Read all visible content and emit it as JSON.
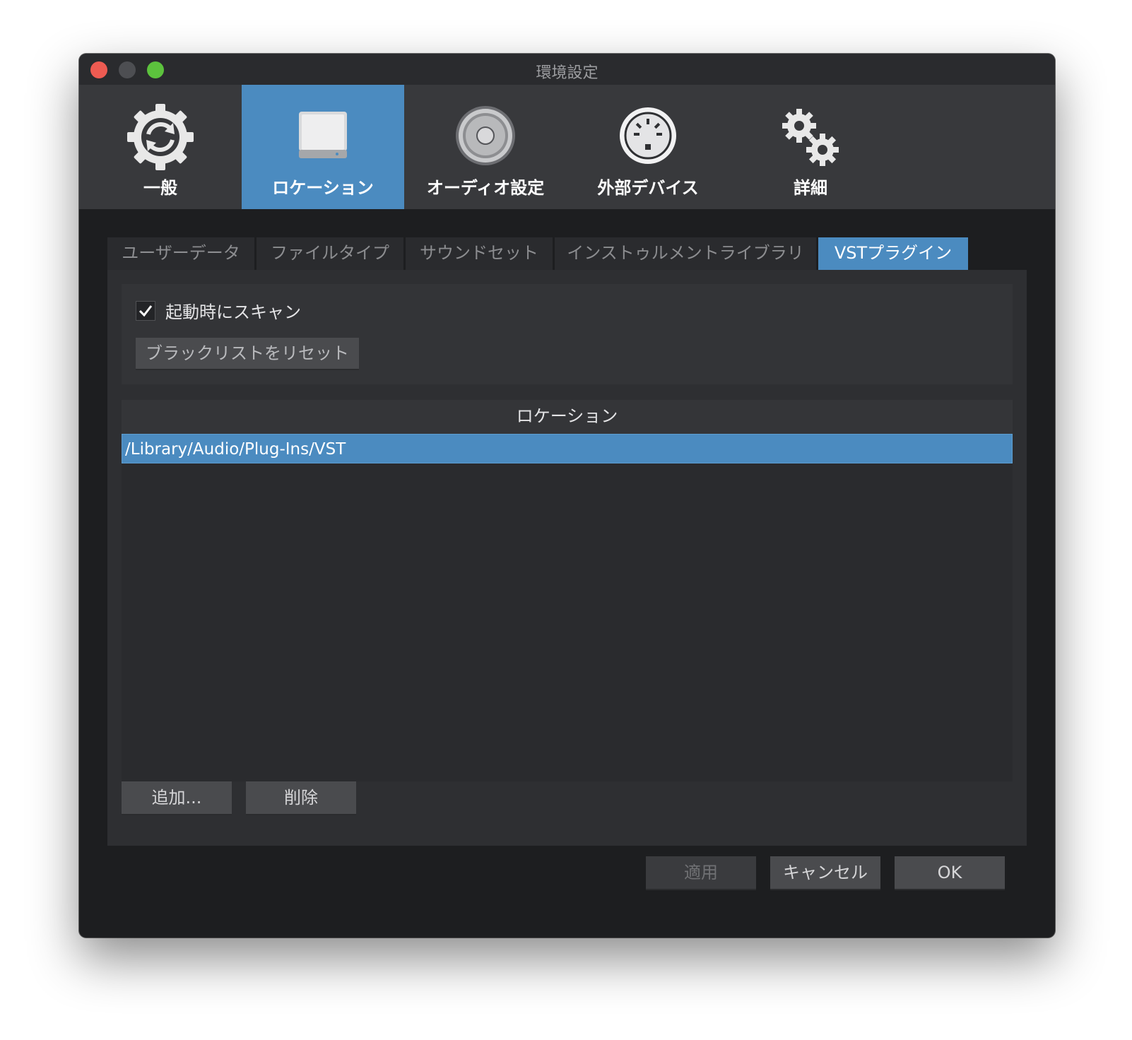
{
  "window": {
    "title": "環境設定"
  },
  "toolbar": {
    "items": [
      {
        "label": "一般",
        "icon": "sync-gear-icon"
      },
      {
        "label": "ロケーション",
        "icon": "hard-drive-icon",
        "active": true
      },
      {
        "label": "オーディオ設定",
        "icon": "speaker-icon"
      },
      {
        "label": "外部デバイス",
        "icon": "midi-port-icon"
      },
      {
        "label": "詳細",
        "icon": "gears-icon"
      }
    ]
  },
  "subtabs": [
    {
      "label": "ユーザーデータ"
    },
    {
      "label": "ファイルタイプ"
    },
    {
      "label": "サウンドセット"
    },
    {
      "label": "インストゥルメントライブラリ"
    },
    {
      "label": "VSTプラグイン",
      "active": true
    }
  ],
  "scan": {
    "checkbox_label": "起動時にスキャン",
    "checked": true,
    "reset_button": "ブラックリストをリセット"
  },
  "locations": {
    "header": "ロケーション",
    "rows": [
      "/Library/Audio/Plug-Ins/VST"
    ]
  },
  "list_buttons": {
    "add": "追加...",
    "remove": "削除"
  },
  "footer": {
    "apply": "適用",
    "cancel": "キャンセル",
    "ok": "OK"
  },
  "colors": {
    "accent": "#4b8bc0",
    "window_bg": "#1d1e20",
    "toolbar_bg": "#38393c"
  }
}
